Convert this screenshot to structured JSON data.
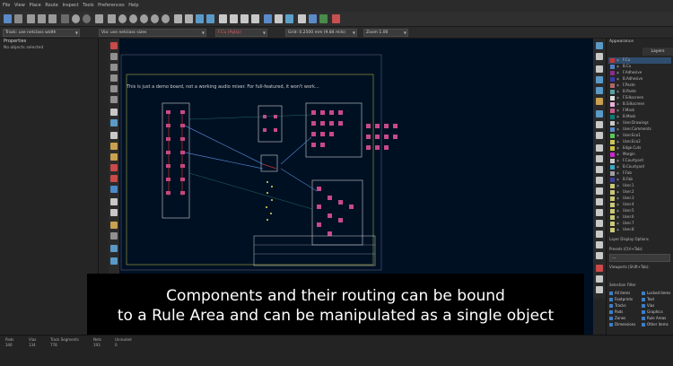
{
  "menu": [
    "File",
    "View",
    "Place",
    "Route",
    "Inspect",
    "Tools",
    "Preferences",
    "Help"
  ],
  "subtoolbar": {
    "track_combo": "Track: use netclass width",
    "via_combo": "Via: use netclass sizes",
    "layer_combo": "F.Cu (PgUp)",
    "grid_combo": "Grid: 0.2500 mm (9.84 mils)",
    "zoom_combo": "Zoom 1.00"
  },
  "properties": {
    "title": "Properties",
    "none_selected": "No objects selected"
  },
  "canvas": {
    "board_note": "This is just a demo board, not a working audio mixer. For full-featured, it won't work..."
  },
  "appearance": {
    "title": "Appearance",
    "layers_tab": "Layers",
    "layers": [
      {
        "name": "F.Cu",
        "color": "#c83434"
      },
      {
        "name": "B.Cu",
        "color": "#4d7fc4"
      },
      {
        "name": "F.Adhesive",
        "color": "#8a2e8a"
      },
      {
        "name": "B.Adhesive",
        "color": "#3a3aa8"
      },
      {
        "name": "F.Paste",
        "color": "#b06868"
      },
      {
        "name": "B.Paste",
        "color": "#5aa0a0"
      },
      {
        "name": "F.Silkscreen",
        "color": "#e0e0e0"
      },
      {
        "name": "B.Silkscreen",
        "color": "#e8b0d8"
      },
      {
        "name": "F.Mask",
        "color": "#c85a8a"
      },
      {
        "name": "B.Mask",
        "color": "#0a7a7a"
      },
      {
        "name": "User.Drawings",
        "color": "#c8c8c8"
      },
      {
        "name": "User.Comments",
        "color": "#5a8ac8"
      },
      {
        "name": "User.Eco1",
        "color": "#5ac85a"
      },
      {
        "name": "User.Eco2",
        "color": "#c8c85a"
      },
      {
        "name": "Edge.Cuts",
        "color": "#d0c040"
      },
      {
        "name": "Margin",
        "color": "#c828c8"
      },
      {
        "name": "F.Courtyard",
        "color": "#c8c8c8"
      },
      {
        "name": "B.Courtyard",
        "color": "#3aa8c8"
      },
      {
        "name": "F.Fab",
        "color": "#a0a0a0"
      },
      {
        "name": "B.Fab",
        "color": "#4040a0"
      },
      {
        "name": "User.1",
        "color": "#c8c878"
      },
      {
        "name": "User.2",
        "color": "#c8c878"
      },
      {
        "name": "User.3",
        "color": "#c8c878"
      },
      {
        "name": "User.4",
        "color": "#c8c878"
      },
      {
        "name": "User.5",
        "color": "#c8c878"
      },
      {
        "name": "User.6",
        "color": "#c8c878"
      },
      {
        "name": "User.7",
        "color": "#c8c878"
      },
      {
        "name": "User.8",
        "color": "#c8c878"
      }
    ],
    "display_options": "Layer Display Options",
    "presets_label": "Presets (Ctrl+Tab):",
    "presets_value": "---",
    "viewports_label": "Viewports (Shift+Tab):",
    "selection_filter": "Selection Filter",
    "filters": [
      "All items",
      "Footprints",
      "Tracks",
      "Pads",
      "Zones",
      "Dimensions",
      "Locked items",
      "Text",
      "Vias",
      "Graphics",
      "Rule Areas",
      "Other items"
    ]
  },
  "status": {
    "labels": [
      "Pads",
      "Vias",
      "Track Segments",
      "Nets",
      "Unrouted"
    ],
    "values": [
      "346",
      "134",
      "778",
      "193",
      "0"
    ]
  },
  "caption": {
    "line1": "Components and their routing can be bound",
    "line2": "to a Rule Area and can be manipulated as a single object"
  }
}
